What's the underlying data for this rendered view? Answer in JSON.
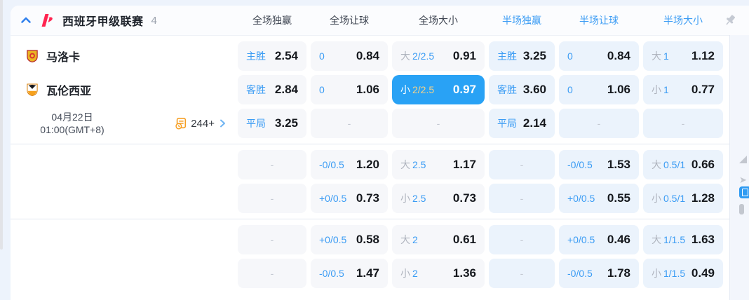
{
  "header": {
    "league_name": "西班牙甲级联赛",
    "match_count": "4",
    "columns": {
      "full_win": "全场独赢",
      "full_handicap": "全场让球",
      "full_ou": "全场大小",
      "half_win": "半场独赢",
      "half_handicap": "半场让球",
      "half_ou": "半场大小"
    }
  },
  "match": {
    "home_team": "马洛卡",
    "away_team": "瓦伦西亚",
    "date": "04月22日",
    "time": "01:00(GMT+8)",
    "markets_count": "244+"
  },
  "odds": {
    "r1": {
      "c1": {
        "label": "主胜",
        "value": "2.54"
      },
      "c2": {
        "label": "0",
        "value": "0.84"
      },
      "c3": {
        "prefix": "大",
        "handicap": "2/2.5",
        "value": "0.91"
      },
      "c4": {
        "label": "主胜",
        "value": "3.25"
      },
      "c5": {
        "label": "0",
        "value": "0.84"
      },
      "c6": {
        "prefix": "大",
        "handicap": "1",
        "value": "1.12"
      }
    },
    "r2": {
      "c1": {
        "label": "客胜",
        "value": "2.84"
      },
      "c2": {
        "label": "0",
        "value": "1.06"
      },
      "c3": {
        "prefix": "小",
        "handicap": "2/2.5",
        "value": "0.97"
      },
      "c4": {
        "label": "客胜",
        "value": "3.60"
      },
      "c5": {
        "label": "0",
        "value": "1.06"
      },
      "c6": {
        "prefix": "小",
        "handicap": "1",
        "value": "0.77"
      }
    },
    "r3": {
      "c1": {
        "label": "平局",
        "value": "3.25"
      },
      "c2": {
        "dash": "-"
      },
      "c3": {
        "dash": "-"
      },
      "c4": {
        "label": "平局",
        "value": "2.14"
      },
      "c5": {
        "dash": "-"
      },
      "c6": {
        "dash": "-"
      }
    },
    "r4": {
      "c1": {
        "dash": "-"
      },
      "c2": {
        "label": "-0/0.5",
        "value": "1.20"
      },
      "c3": {
        "prefix": "大",
        "handicap": "2.5",
        "value": "1.17"
      },
      "c4": {
        "dash": "-"
      },
      "c5": {
        "label": "-0/0.5",
        "value": "1.53"
      },
      "c6": {
        "prefix": "大",
        "handicap": "0.5/1",
        "value": "0.66"
      }
    },
    "r5": {
      "c1": {
        "dash": "-"
      },
      "c2": {
        "label": "+0/0.5",
        "value": "0.73"
      },
      "c3": {
        "prefix": "小",
        "handicap": "2.5",
        "value": "0.73"
      },
      "c4": {
        "dash": "-"
      },
      "c5": {
        "label": "+0/0.5",
        "value": "0.55"
      },
      "c6": {
        "prefix": "小",
        "handicap": "0.5/1",
        "value": "1.28"
      }
    },
    "r6": {
      "c1": {
        "dash": "-"
      },
      "c2": {
        "label": "+0/0.5",
        "value": "0.58"
      },
      "c3": {
        "prefix": "大",
        "handicap": "2",
        "value": "0.61"
      },
      "c4": {
        "dash": "-"
      },
      "c5": {
        "label": "+0/0.5",
        "value": "0.46"
      },
      "c6": {
        "prefix": "大",
        "handicap": "1/1.5",
        "value": "1.63"
      }
    },
    "r7": {
      "c1": {
        "dash": "-"
      },
      "c2": {
        "label": "-0/0.5",
        "value": "1.47"
      },
      "c3": {
        "prefix": "小",
        "handicap": "2",
        "value": "1.36"
      },
      "c4": {
        "dash": "-"
      },
      "c5": {
        "label": "-0/0.5",
        "value": "1.78"
      },
      "c6": {
        "prefix": "小",
        "handicap": "1/1.5",
        "value": "0.49"
      }
    }
  },
  "icons": {
    "collapse": "chevron-up",
    "league_logo": "laliga-mark",
    "pin": "pushpin",
    "markets": "odds-list-clock",
    "more": "chevron-right",
    "home_crest": "mallorca-crest",
    "away_crest": "valencia-crest"
  },
  "colors": {
    "accent_blue": "#3b9cf4",
    "highlight_bg": "#29a2f5",
    "highlight_handicap": "#f3d189",
    "markets_icon_orange": "#f69e21",
    "league_logo_red": "#ff2450"
  }
}
